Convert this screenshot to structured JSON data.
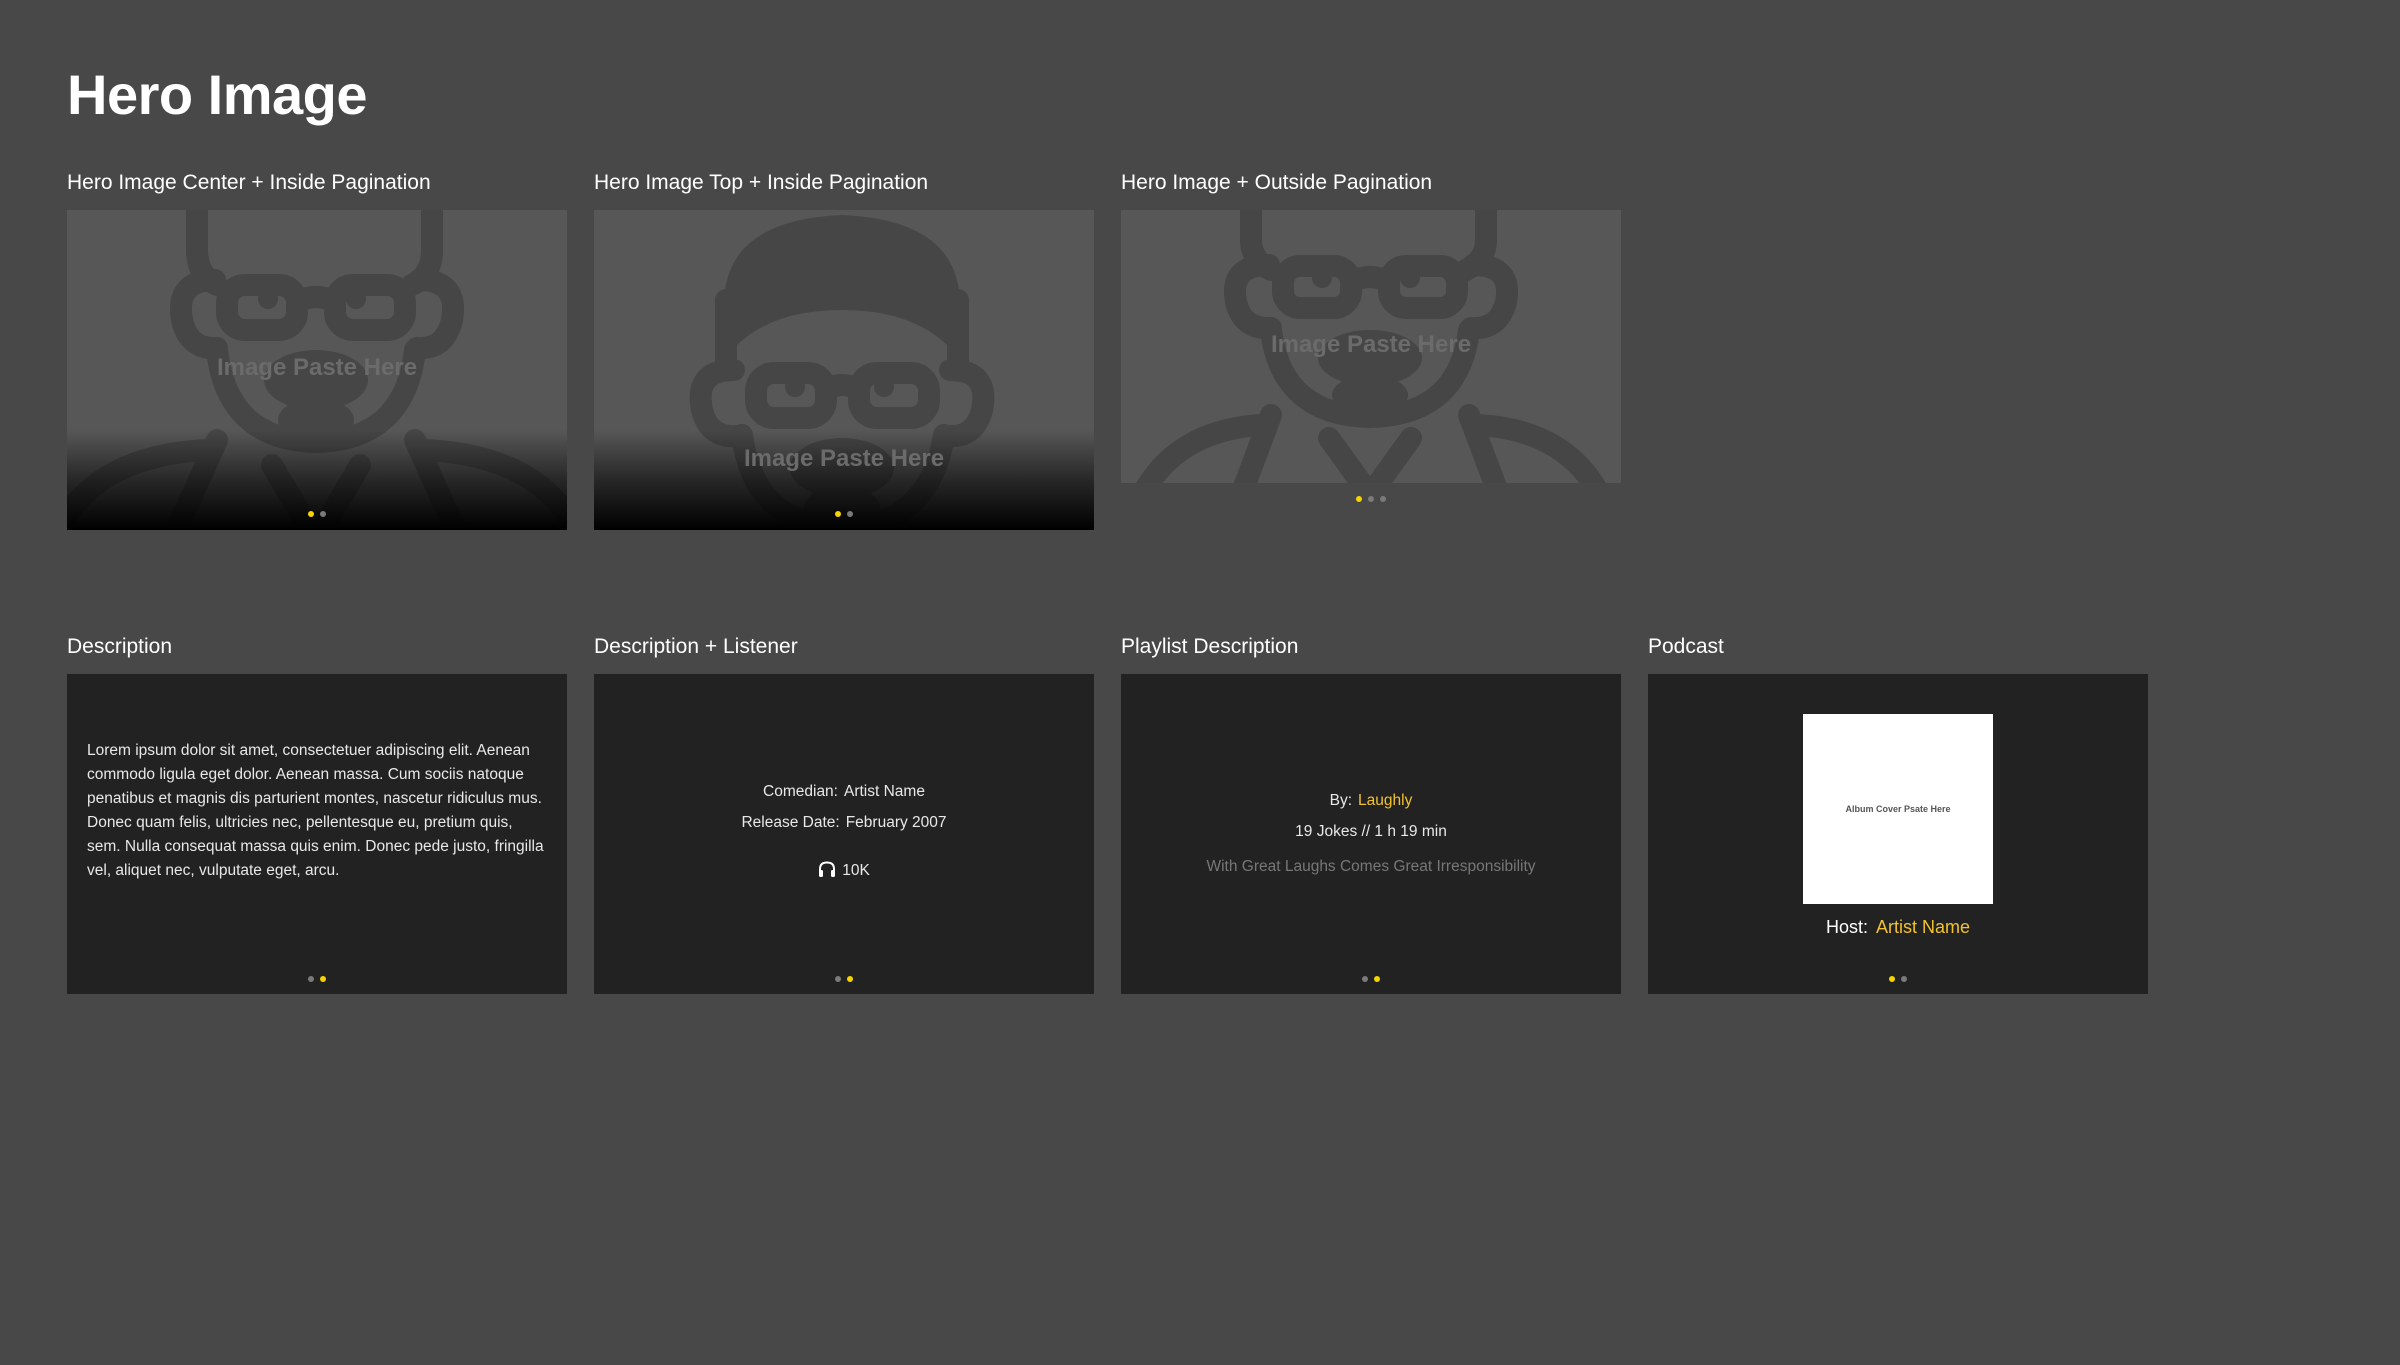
{
  "page": {
    "title": "Hero Image"
  },
  "placeholder_text": "Image Paste Here",
  "colors": {
    "background": "#484848",
    "card": "#222222",
    "accent": "#f5d400",
    "link": "#f2c230"
  },
  "hero_cards": [
    {
      "label": "Hero Image Center + Inside Pagination",
      "pagination": {
        "count": 2,
        "active": 1
      }
    },
    {
      "label": "Hero Image Top + Inside Pagination",
      "pagination": {
        "count": 2,
        "active": 1
      }
    },
    {
      "label": "Hero Image + Outside Pagination",
      "pagination": {
        "count": 3,
        "active": 1
      }
    }
  ],
  "description_cards": [
    {
      "label": "Description",
      "text": "Lorem ipsum dolor sit amet, consectetuer adipiscing elit. Aenean commodo ligula eget dolor. Aenean massa. Cum sociis natoque penatibus et magnis dis parturient montes, nascetur ridiculus mus. Donec quam felis, ultricies nec, pellentesque eu, pretium quis, sem. Nulla consequat massa quis enim. Donec pede justo, fringilla vel, aliquet nec, vulputate eget, arcu.",
      "pagination": {
        "count": 2,
        "active": 2
      }
    },
    {
      "label": "Description + Listener",
      "comedian_label": "Comedian:",
      "comedian_value": "Artist Name",
      "release_label": "Release Date:",
      "release_value": "February 2007",
      "listener_icon": "headphones-icon",
      "listeners": "10K",
      "pagination": {
        "count": 2,
        "active": 2
      }
    },
    {
      "label": "Playlist Description",
      "by_label": "By:",
      "by_value": "Laughly",
      "stats": "19 Jokes // 1 h 19 min",
      "tagline": "With Great Laughs Comes Great Irresponsibility",
      "pagination": {
        "count": 2,
        "active": 2
      }
    },
    {
      "label": "Podcast",
      "cover_text": "Album Cover Psate Here",
      "host_label": "Host:",
      "host_value": "Artist Name",
      "pagination": {
        "count": 2,
        "active": 1
      }
    }
  ]
}
